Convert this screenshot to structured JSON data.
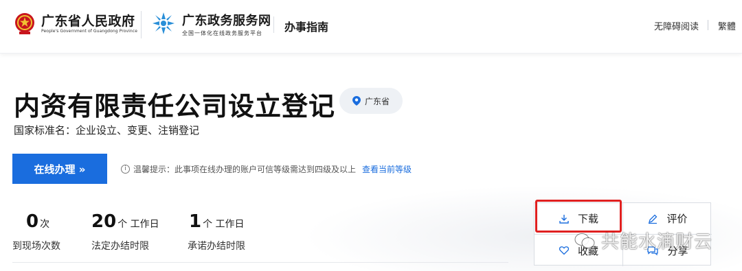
{
  "header": {
    "gov_name": "广东省人民政府",
    "gov_name_en": "People's Government of Guangdong Province",
    "service_name": "广东政务服务网",
    "service_sub": "全国一体化在线政务服务平台",
    "guide_label": "办事指南",
    "accessibility_label": "无障碍阅读",
    "traditional_label": "繁體"
  },
  "main": {
    "title": "内资有限责任公司设立登记",
    "region": "广东省",
    "subtitle": "国家标准名：企业设立、变更、注销登记",
    "online_button": "在线办理 »",
    "tip_text": "温馨提示：此事项在线办理的账户可信等级需达到四级及以上",
    "tip_link": "查看当前等级"
  },
  "stats": [
    {
      "value": "0",
      "unit": "次",
      "label": "到现场次数"
    },
    {
      "value": "20",
      "unit": "个 工作日",
      "label": "法定办结时限"
    },
    {
      "value": "1",
      "unit": "个 工作日",
      "label": "承诺办结时限"
    }
  ],
  "actions": {
    "download": "下载",
    "review": "评价",
    "favorite": "收藏",
    "share": "分享"
  },
  "watermark": "共能水滴财云",
  "colors": {
    "primary": "#1a6dde",
    "highlight": "#e02020"
  }
}
